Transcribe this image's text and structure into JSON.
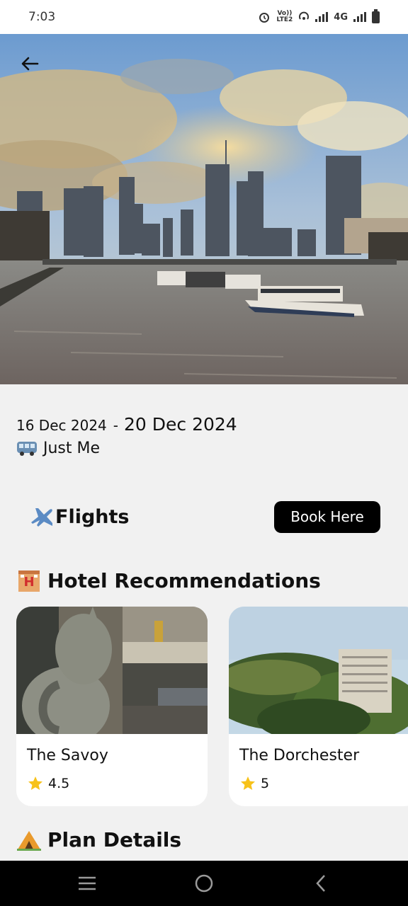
{
  "status_bar": {
    "time": "7:03",
    "network": "4G",
    "lte_label": "LTE2",
    "volte_label": "Vo)) "
  },
  "trip": {
    "start_date": "16 Dec 2024",
    "separator": "-",
    "end_date": "20 Dec 2024",
    "traveler": "Just Me"
  },
  "flights": {
    "title": "Flights",
    "book_label": "Book Here"
  },
  "hotels": {
    "title": "Hotel Recommendations",
    "items": [
      {
        "name": "The Savoy",
        "rating": "4.5"
      },
      {
        "name": "The Dorchester",
        "rating": "5"
      }
    ]
  },
  "plan": {
    "title": "Plan Details"
  },
  "colors": {
    "accent": "#000000",
    "background": "#f1f1f1",
    "star": "#f7c21a"
  },
  "icons": [
    "back-arrow-icon",
    "bus-icon",
    "airplane-icon",
    "hotel-icon",
    "camping-icon",
    "star-icon",
    "menu-icon",
    "home-icon",
    "back-icon"
  ]
}
